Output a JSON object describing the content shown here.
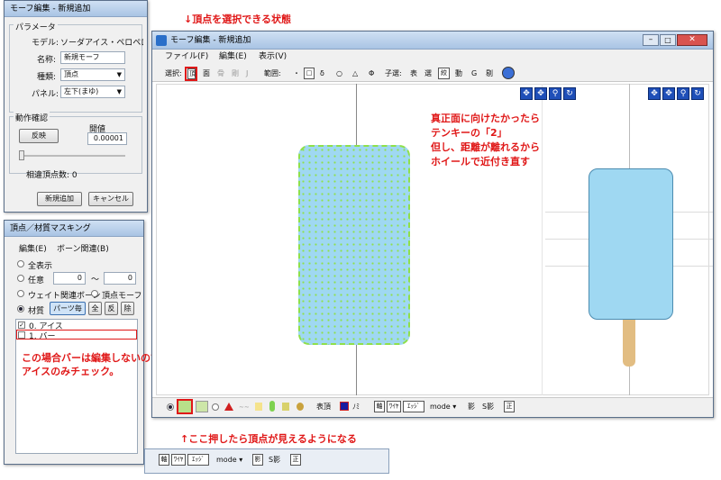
{
  "notes": {
    "top": "↓頂点を選択できる状態",
    "right_line1": "真正面に向けたかったら",
    "right_line2": "テンキーの「2」",
    "right_line3": "但し、距離が離れるから",
    "right_line4": "ホイールで近付き直す",
    "left_line1": "この場合バーは編集しないので",
    "left_line2": "アイスのみチェック。",
    "bottom": "↑ここ押したら頂点が見えるようになる"
  },
  "morph_panel": {
    "title": "モーフ編集 - 新規追加",
    "group_label": "パラメータ",
    "model_label": "モデル:",
    "model_value": "ソーダアイス・ペロペロくん",
    "name_label": "名称:",
    "name_value": "新規モーフ",
    "type_label": "種類:",
    "type_value": "頂点",
    "panel_label": "パネル:",
    "panel_value": "左下(まゆ)",
    "check_label": "動作確認",
    "reflect_button": "反映",
    "ratio_label": "開値",
    "ratio_value": "0.00001",
    "relative_count": "相違頂点数: 0",
    "add_button": "新規追加",
    "cancel_button": "キャンセル"
  },
  "mask_panel": {
    "title": "頂点／材質マスキング",
    "menu_edit": "編集(E)",
    "menu_bone": "ボーン関連(B)",
    "opt_all": "全表示",
    "opt_any": "任意",
    "any_from": "0",
    "any_to": "0",
    "opt_weight": "ウェイト関連ボーン",
    "opt_vmorph": "頂点モーフ",
    "opt_material": "材質",
    "btn_parts": "パーツ毎",
    "btn_all": "全",
    "btn_invert": "反",
    "btn_remove": "除",
    "materials": [
      "0. アイス",
      "1. バー"
    ]
  },
  "main_window": {
    "title": "モーフ編集 - 新規追加",
    "menu": [
      "ファイル(F)",
      "編集(E)",
      "表示(V)"
    ],
    "select_label": "選択:",
    "select_items": [
      "頂",
      "面",
      "骨",
      "剛",
      "J"
    ],
    "range_label": "範囲:",
    "range_items": [
      "・",
      "□",
      "δ",
      "○",
      "△",
      "Φ"
    ],
    "child_label": "子選:",
    "child_items": [
      "表",
      "選",
      "絞",
      "動",
      "G",
      "剔"
    ],
    "bottom_items": [
      "表頂",
      "ﾉﾐ",
      "軸",
      "ﾜｲﾔ",
      "ｴｯｼﾞ",
      "mode ▾",
      "影",
      "S影",
      "正"
    ]
  },
  "lower_toolbar": {
    "items": [
      "軸",
      "ﾜｲﾔ",
      "ｴｯｼﾞ",
      "mode ▾",
      "影",
      "S影",
      "正"
    ]
  },
  "colors": {
    "note_red": "#e01818",
    "ice_blue": "#9fd8f2",
    "vertex_green": "#8fe04a",
    "bar_wood": "#e2bd82",
    "highlight_red": "#e01818"
  }
}
